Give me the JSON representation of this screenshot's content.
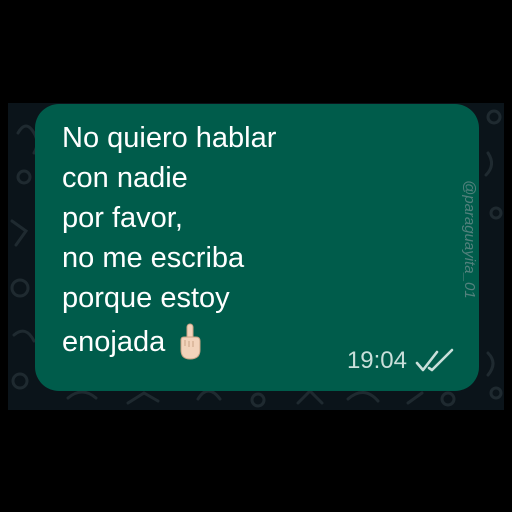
{
  "message": {
    "lines": [
      "No quiero hablar",
      "con nadie",
      "por favor,",
      "no me escriba",
      "porque estoy",
      "enojada"
    ],
    "emoji": "middle-finger-emoji",
    "time": "19:04",
    "status_icon": "double-check-icon"
  },
  "watermark": "@paraguayita_01",
  "colors": {
    "background": "#000000",
    "chat_background": "#0b141a",
    "bubble": "#005c4b",
    "text": "#ffffff",
    "timestamp": "#c9dfda",
    "ticks": "#c9dfda"
  }
}
